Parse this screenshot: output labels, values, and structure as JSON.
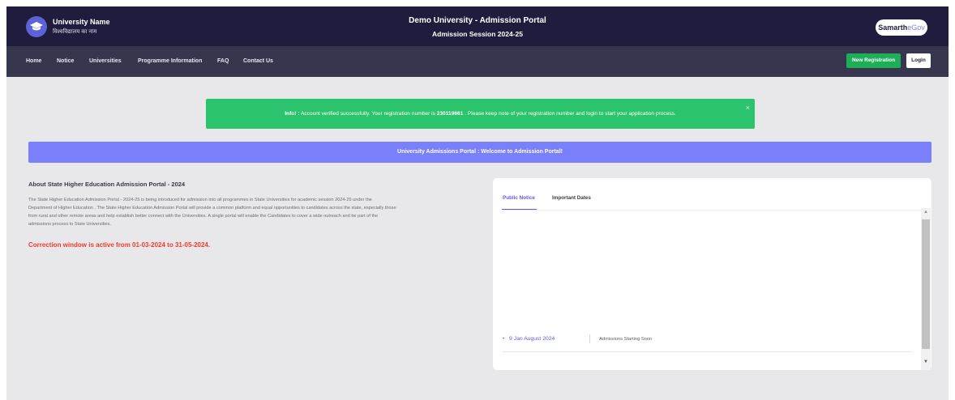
{
  "header": {
    "university_name": "University Name",
    "university_name_hindi": "विश्वविद्यालय का नाम",
    "portal_title": "Demo University - Admission Portal",
    "session": "Admission Session 2024-25",
    "brand_part1": "Samarth",
    "brand_part2": "eGov",
    "logo_icon": "graduation-cap-icon"
  },
  "nav": {
    "items": [
      "Home",
      "Notice",
      "Universities",
      "Programme Information",
      "FAQ",
      "Contact Us"
    ],
    "new_registration": "New Registration",
    "login": "Login"
  },
  "alert": {
    "label": "Info! :",
    "before": " Account verified successfully. Your registration number is ",
    "registration_number": "230119661",
    "after": " . Please keep note of your registration number and login to start your application process.",
    "close": "×"
  },
  "welcome": "University Admissions Portal : Welcome to Admission Portal!",
  "about": {
    "title": "About State Higher Education Admission Portal - 2024",
    "lines": [
      "The State Higher Education Admission Portal - 2024-25 is being introduced for admission into all programmes in State Universities for academic session 2024-25 under the",
      "Department of Higher Education . The State Higher Education Admission Portal will provide a common platform and equal opportunities to candidates across the state, especially those",
      "from rural and other remote areas and help establish better connect with the Universities. A single portal will enable the Candidates to cover a wide outreach and be part of the",
      "admissions process to State Universities."
    ],
    "correction": "Correction window is active from 01-03-2024 to 31-05-2024."
  },
  "notices": {
    "tabs": [
      "Public Notice",
      "Important Dates"
    ],
    "items": [
      {
        "date": "9 Jan August 2024",
        "text": "Admissions Starting Soon"
      }
    ]
  },
  "colors": {
    "header_bg": "#1f1c3d",
    "nav_bg": "#37364f",
    "alert_green": "#2bc36b",
    "welcome_blue": "#7a7ffc",
    "correction_red": "#f03b2c",
    "register_green": "#1fae58",
    "accent": "#5c5ce0"
  }
}
